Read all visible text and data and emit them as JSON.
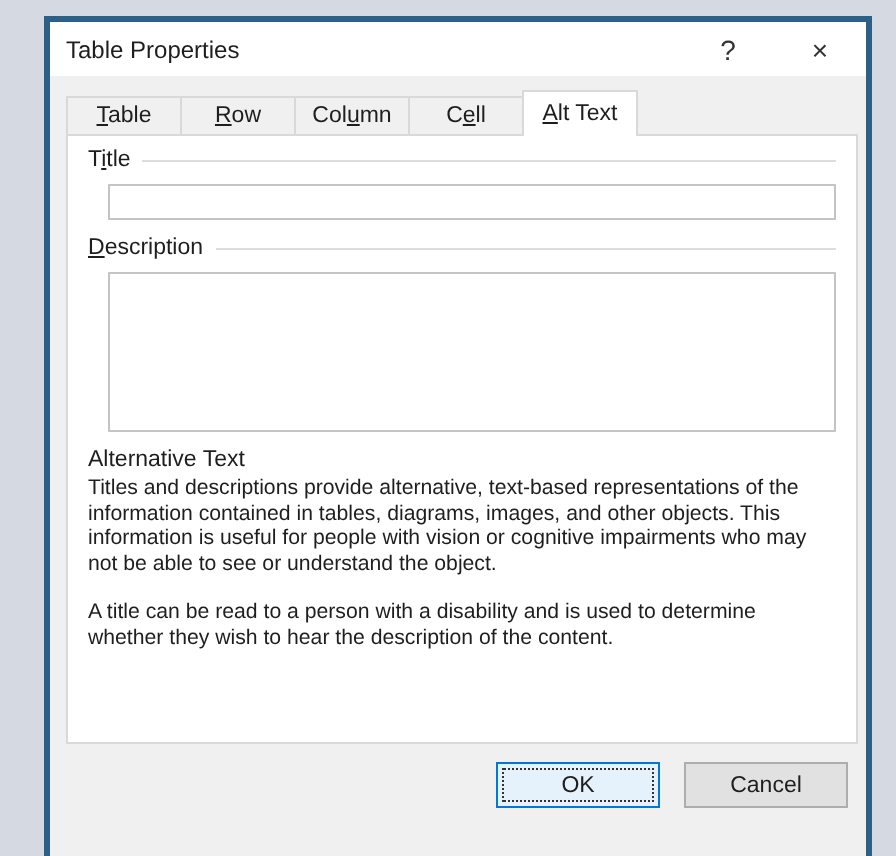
{
  "window": {
    "title": "Table Properties",
    "help": "?",
    "close": "×"
  },
  "tabs": [
    {
      "access_key": "T",
      "after": "able",
      "selected": false
    },
    {
      "access_key": "R",
      "after": "ow",
      "selected": false
    },
    {
      "before": "Col",
      "access_key": "u",
      "after": "mn",
      "selected": false
    },
    {
      "before": "C",
      "access_key": "e",
      "after": "ll",
      "selected": false
    },
    {
      "access_key": "A",
      "after": "lt Text",
      "selected": true
    }
  ],
  "title_group": {
    "before": "T",
    "access_key": "i",
    "after": "tle"
  },
  "description_group": {
    "access_key": "D",
    "after": "escription"
  },
  "info": {
    "heading": "Alternative Text",
    "paragraphs": [
      "Titles and descriptions provide alternative, text-based representations of the information contained in tables, diagrams, images, and other objects. This information is useful for people with vision or cognitive impairments who may not be able to see or understand the object.",
      "A title can be read to a person with a disability and is used to determine whether they wish to hear the description of the content."
    ]
  },
  "buttons": [
    {
      "label": "OK",
      "default": true
    },
    {
      "label": "Cancel",
      "default": false
    }
  ]
}
